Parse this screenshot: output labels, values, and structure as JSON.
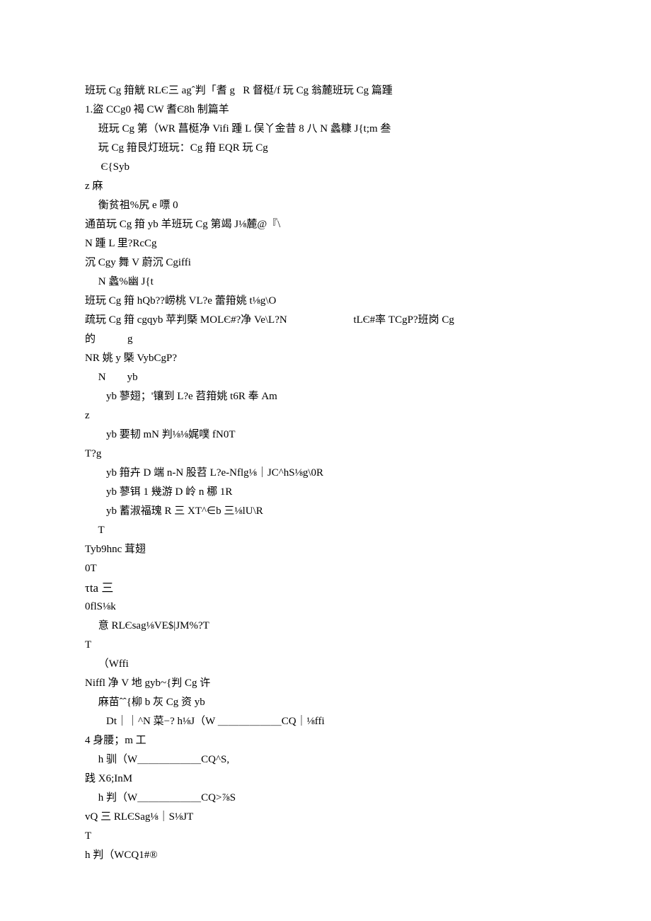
{
  "lines": [
    "班玩 Cg 箝觥 RLЄ三 agˆ判「耆 g   R 督梃/f 玩 Cg 翁麓班玩 Cg 篇踵",
    "1.盜 CCg0 褐 CW 耆Є8h 制篇羊",
    "     班玩 Cg 第（WR 菖梃净 Vifi 踵 L 俣丫金昔 8 八 N 蠡糠 J{t;m 叁",
    "     玩 Cg 箝艮灯班玩：Cg 箝 EQR 玩 Cg",
    "      Є{Syb",
    "z 麻",
    "     衡贫祖%尻 e 嘌 0",
    "通苗玩 Cg 箝 yb 羊班玩 Cg 第竭 J⅛麓@『\\",
    "N 踵 L 里?RcCg",
    "沉 Cgy 舞 V 蔚沉 Cgiffi",
    "     N 蠡%幽 J{t",
    "班玩 Cg 箝 hQb??崂桃 VL?e 蕾箝姚 t⅛g\\O",
    "疏玩 Cg 箝 cgqyb 苹判槩 MOLЄ#?净 Ve\\L?N                         tLЄ#率 TCgP?班岗 Cg",
    "的            g",
    "NR 姚 y 槩 VybCgP?",
    "     N        yb",
    "        yb 蓼翅；'镶到 L?e 苕箝姚 t6R 奉 Am",
    "z",
    "        yb 要韧 mN 判⅛⅛娓噗 fN0T",
    "T?g",
    "        yb 箝卉 D 端 n-N 股苕 L?e-Nflg⅛｜JC^hS⅛g\\0R",
    "        yb 蓼铒 1 幾游 D 岭 n 梛 1R",
    "        yb 蓄淑福瑰 R 三 XT^∈b 三⅛lU\\R",
    "     T",
    "Tyb9hnc 茸翅",
    "0T",
    "τta 三",
    "0flS⅛k",
    "     意 RLЄsag⅛VE$|JM%?T",
    "T",
    "     （Wffi",
    "Niffl 净 V 地 gyb~{判 Cg 许",
    "     麻苗ˆˆ{柳 b 灰 Cg 资 yb",
    "        Dt｜｜^N 菜−? h⅛J（W ＿＿＿＿＿＿CQ｜⅛ffi",
    "4 身腰；m 工",
    "     h 驯（W＿＿＿＿＿＿CQ^S,",
    "践 X6;InM",
    "     h 判（W＿＿＿＿＿＿CQ>⅞S",
    "vQ 三 RLЄSag⅛｜S⅛JT",
    "T",
    "h 判（WCQ1#®"
  ]
}
